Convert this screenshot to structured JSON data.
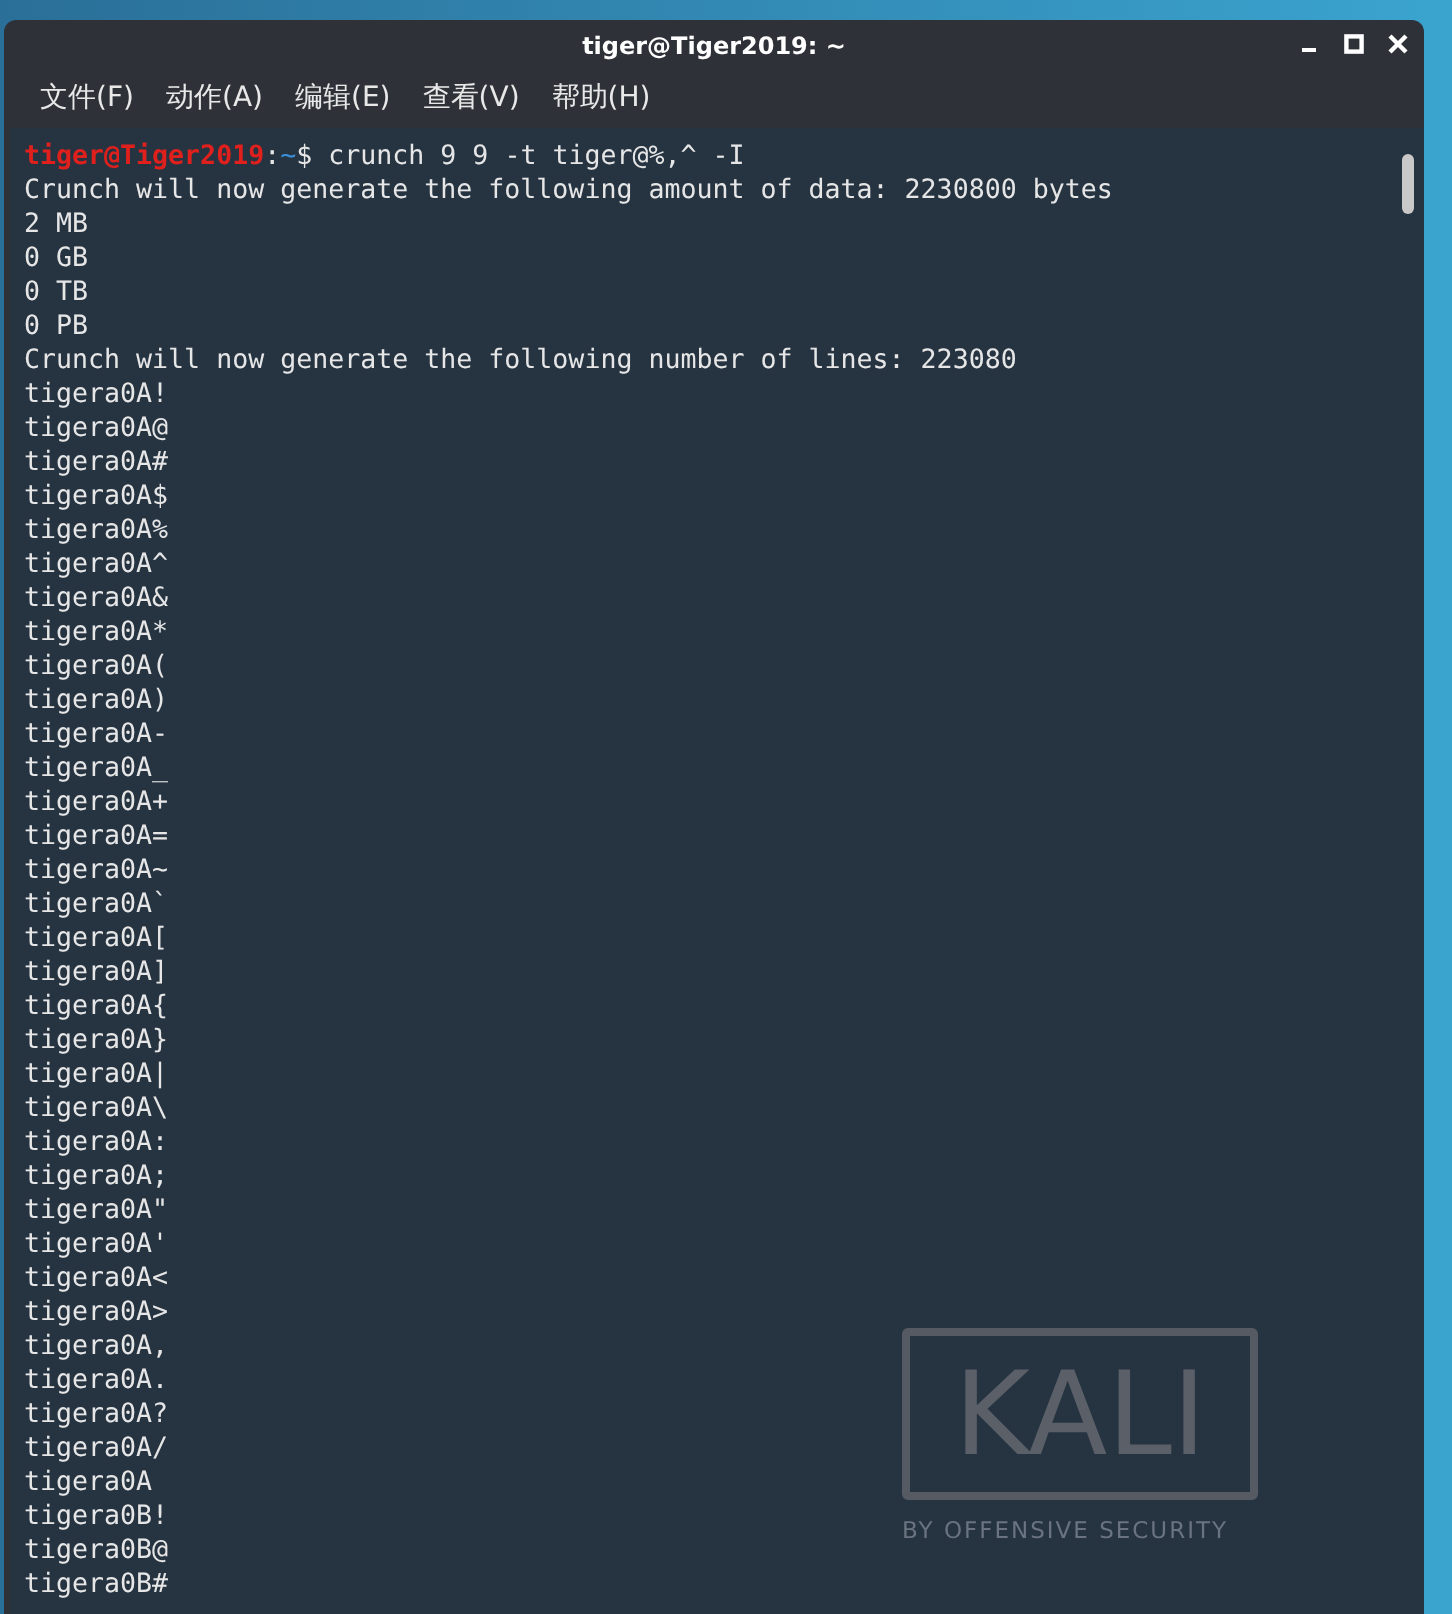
{
  "window": {
    "title": "tiger@Tiger2019: ~"
  },
  "menu": [
    "文件(F)",
    "动作(A)",
    "编辑(E)",
    "查看(V)",
    "帮助(H)"
  ],
  "terminal": {
    "prompt": {
      "user_host": "tiger@Tiger2019",
      "separator": ":",
      "path": "~",
      "command": "$ crunch 9 9 -t tiger@%,^ -I"
    },
    "output": [
      "Crunch will now generate the following amount of data: 2230800 bytes",
      "2 MB",
      "0 GB",
      "0 TB",
      "0 PB",
      "Crunch will now generate the following number of lines: 223080",
      "tigera0A!",
      "tigera0A@",
      "tigera0A#",
      "tigera0A$",
      "tigera0A%",
      "tigera0A^",
      "tigera0A&",
      "tigera0A*",
      "tigera0A(",
      "tigera0A)",
      "tigera0A-",
      "tigera0A_",
      "tigera0A+",
      "tigera0A=",
      "tigera0A~",
      "tigera0A`",
      "tigera0A[",
      "tigera0A]",
      "tigera0A{",
      "tigera0A}",
      "tigera0A|",
      "tigera0A\\",
      "tigera0A:",
      "tigera0A;",
      "tigera0A\"",
      "tigera0A'",
      "tigera0A<",
      "tigera0A>",
      "tigera0A,",
      "tigera0A.",
      "tigera0A?",
      "tigera0A/",
      "tigera0A ",
      "tigera0B!",
      "tigera0B@",
      "tigera0B#"
    ]
  },
  "background_logo": {
    "name": "KALI",
    "tagline": "BY OFFENSIVE SECURITY"
  }
}
